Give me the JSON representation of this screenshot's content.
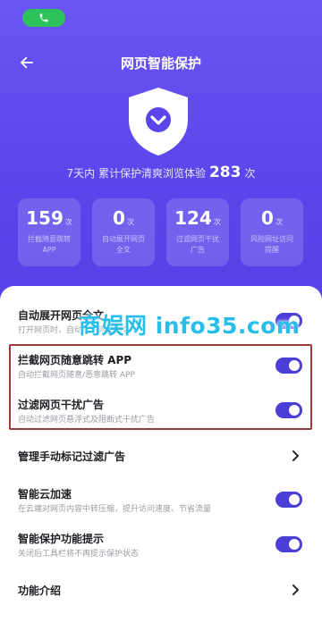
{
  "header": {
    "title": "网页智能保护",
    "stat_prefix": "7天内 累计保护清爽浏览体验",
    "stat_count": "283",
    "stat_suffix": "次"
  },
  "cards": [
    {
      "value": "159",
      "unit": "次",
      "label": "拦截随意跳转 APP"
    },
    {
      "value": "0",
      "unit": "次",
      "label": "自动展开网页全文"
    },
    {
      "value": "124",
      "unit": "次",
      "label": "过滤网页干扰广告"
    },
    {
      "value": "0",
      "unit": "次",
      "label": "风险网址访问提醒"
    }
  ],
  "settings": [
    {
      "label": "自动展开网页全文",
      "sub": "打开网页时，自动展开网页内容",
      "enabled": true
    },
    {
      "label": "拦截网页随意跳转 APP",
      "sub": "自动拦截网页随意/恶意跳转 APP",
      "enabled": true
    },
    {
      "label": "过滤网页干扰广告",
      "sub": "自动过滤网页悬浮式及阻断式干扰广告",
      "enabled": true
    },
    {
      "label": "管理手动标记过滤广告"
    },
    {
      "label": "智能云加速",
      "sub": "在云端对网页内容中转压缩，提升访问速度、节省流量",
      "enabled": true
    },
    {
      "label": "智能保护功能提示",
      "sub": "关闭后工具栏将不再提示保护状态",
      "enabled": true
    },
    {
      "label": "功能介绍"
    }
  ],
  "watermark": "商娱网 info35.com",
  "colors": {
    "accent": "#5b46ec",
    "toggle": "#4c3fd8",
    "highlight": "#9e3a3a"
  }
}
